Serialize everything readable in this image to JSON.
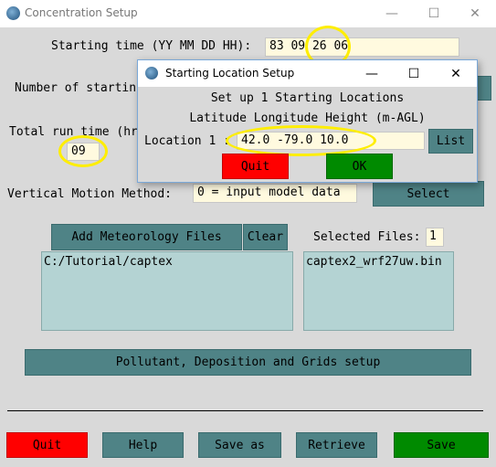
{
  "window": {
    "title": "Concentration Setup",
    "minimize_glyph": "—",
    "maximize_glyph": "☐",
    "close_glyph": "✕"
  },
  "form": {
    "start_time_label": "Starting time (YY MM DD HH):",
    "start_time_value": "83 09 26 06",
    "num_locations_label": "Number of startin",
    "run_time_label": "Total run time (hr",
    "run_time_value": "09",
    "vertical_label": "Vertical Motion Method:",
    "vertical_value": "0 = input model data",
    "select_label": "Select"
  },
  "met": {
    "add_files_label": "Add Meteorology Files",
    "clear_label": "Clear",
    "selected_files_label": "Selected Files:",
    "selected_files_count": "1",
    "directory": "C:/Tutorial/captex",
    "file": "captex2_wrf27uw.bin"
  },
  "pollutant_button": "Pollutant, Deposition and Grids setup",
  "bottom_buttons": {
    "quit": "Quit",
    "help": "Help",
    "save_as": "Save as",
    "retrieve": "Retrieve",
    "save": "Save"
  },
  "dialog": {
    "title": "Starting Location Setup",
    "heading": "Set up 1 Starting Locations",
    "subheading": "Latitude Longitude Height (m-AGL)",
    "location_label": "Location 1 :",
    "location_value": "42.0 -79.0 10.0",
    "list_label": "List",
    "quit_label": "Quit",
    "ok_label": "OK",
    "minimize_glyph": "—",
    "maximize_glyph": "☐",
    "close_glyph": "✕"
  },
  "colors": {
    "field_bg": "#fffadf",
    "button_teal": "#4f8386",
    "quit_red": "#ff0000",
    "save_green": "#008a00",
    "listbox_bg": "#b4d3d3",
    "highlight_yellow": "#ffee00"
  }
}
